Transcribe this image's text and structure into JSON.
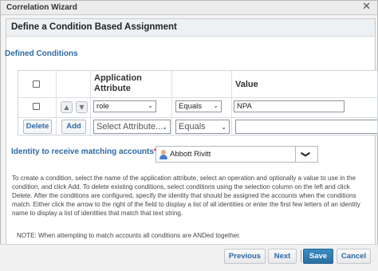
{
  "window": {
    "title": "Correlation Wizard",
    "close_glyph": "✕"
  },
  "dialog": {
    "heading": "Define a Condition Based Assignment"
  },
  "conditions": {
    "section_title": "Defined Conditions",
    "headers": {
      "attribute": "Application Attribute",
      "value": "Value"
    },
    "row": {
      "attribute": "role",
      "operation": "Equals",
      "value": "NPA"
    },
    "new_row": {
      "delete_label": "Delete",
      "add_label": "Add",
      "attribute_placeholder": "Select Attribute...",
      "operation": "Equals",
      "value": ""
    }
  },
  "identity": {
    "label": "Identity to receive matching accounts",
    "required_marker": "*",
    "selected_name": "Abbott Rivitt",
    "icon": "person-icon",
    "caret": "❯"
  },
  "help": {
    "text": "To create a condition, select the name of the application attribute, select an operation and optionally a value to use in the condition, and click Add. To delete existing conditions, select conditions using the selection column on the left and click Delete. After the conditions are configured, specify the identity that should be assigned the accounts when the conditions match. Either click the arrow to the right of the field to display a list of all identities or enter the first few letters of an identity name to display a list of identities that match that text string.",
    "note": "NOTE: When attempting to match accounts all conditions are ANDed together."
  },
  "footer": {
    "previous": "Previous",
    "next": "Next",
    "save": "Save",
    "cancel": "Cancel"
  },
  "colors": {
    "accent": "#2d6aa5",
    "primary_button": "#2a6fa0",
    "required": "#cc0000"
  }
}
